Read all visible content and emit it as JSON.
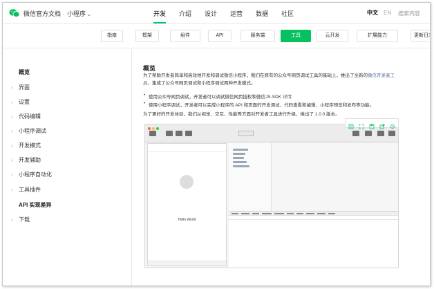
{
  "header": {
    "brand": "微信官方文档",
    "product": "小程序",
    "nav": [
      "开发",
      "介绍",
      "设计",
      "运营",
      "数据",
      "社区"
    ],
    "active_nav": "开发",
    "lang_zh": "中文",
    "lang_en": "EN",
    "search_placeholder": "搜索内容"
  },
  "subtabs": [
    "指南",
    "框架",
    "组件",
    "API",
    "服务端",
    "工具",
    "云开发",
    "扩展能力",
    "更新日志"
  ],
  "active_subtab": "工具",
  "sidebar": {
    "items": [
      {
        "label": "概览",
        "arrow": false
      },
      {
        "label": "界面",
        "arrow": true
      },
      {
        "label": "设置",
        "arrow": true
      },
      {
        "label": "代码编辑",
        "arrow": true
      },
      {
        "label": "小程序调试",
        "arrow": true
      },
      {
        "label": "开发模式",
        "arrow": true
      },
      {
        "label": "开发辅助",
        "arrow": true
      },
      {
        "label": "小程序自动化",
        "arrow": true
      },
      {
        "label": "工具插件",
        "arrow": true
      },
      {
        "label": "API 实现差异",
        "arrow": false
      },
      {
        "label": "下载",
        "arrow": true
      }
    ]
  },
  "content": {
    "title": "概览",
    "intro_1": "为了帮助开发者简单和高效地开发和调试微信小程序，我们在原有的公众号网页调试工具的基础上，推出了全新的",
    "intro_link": "微信开发者工具",
    "intro_2": "，集成了公众号网页调试和小程序调试两种开发模式。",
    "bullet_1": "使用公众号网页调试，开发者可以调试微信网页授权和微信JS-SDK",
    "bullet_1_link": "详情",
    "bullet_2": "使用小程序调试，开发者可以完成小程序的 API 和页面的开发调试、代码查看和编辑、小程序预览和发布等功能。",
    "closing": "为了更好的开发体验，我们从视觉、交互、性能等方面对开发者工具进行升级，推出了 1.0.0 版本。"
  },
  "screenshot": {
    "hello_text": "Hello World"
  },
  "colors": {
    "accent": "#07c160",
    "link": "#576b95"
  }
}
